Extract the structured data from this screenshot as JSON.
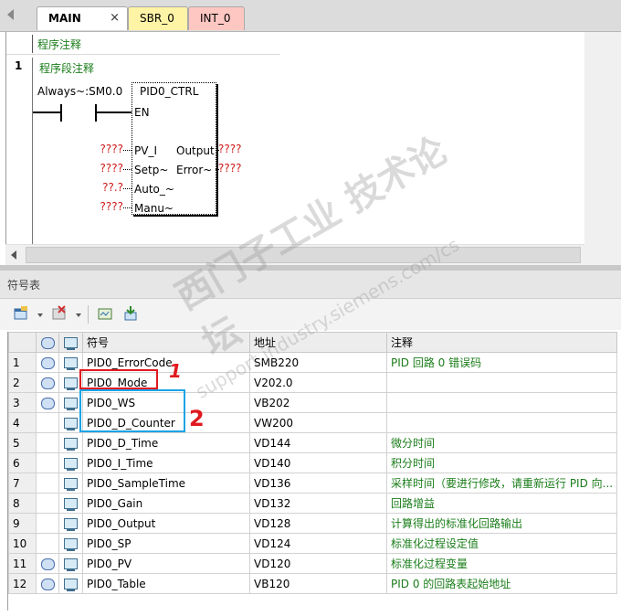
{
  "tabs": [
    {
      "label": "MAIN",
      "close": "×"
    },
    {
      "label": "SBR_0"
    },
    {
      "label": "INT_0"
    }
  ],
  "editor": {
    "program_comment": "程序注释",
    "network_number": "1",
    "network_comment": "程序段注释",
    "contact_label": "Always~:SM0.0",
    "block": {
      "title": "PID0_CTRL",
      "en": "EN",
      "inputs": [
        "PV_I",
        "Setp~",
        "Auto_~",
        "Manu~"
      ],
      "outputs": [
        "Output",
        "Error~"
      ]
    },
    "input_params": [
      "????",
      "????",
      "??.?",
      "????"
    ],
    "output_params": [
      "????",
      "????"
    ]
  },
  "symbol_panel": {
    "title": "符号表",
    "columns": [
      "符号",
      "地址",
      "注释"
    ],
    "rows": [
      {
        "num": "1",
        "globe": true,
        "symbol": "PID0_ErrorCode",
        "address": "SMB220",
        "comment": "PID 回路 0 错误码"
      },
      {
        "num": "2",
        "globe": true,
        "symbol": "PID0_Mode",
        "address": "V202.0",
        "comment": ""
      },
      {
        "num": "3",
        "globe": true,
        "symbol": "PID0_WS",
        "address": "VB202",
        "comment": ""
      },
      {
        "num": "4",
        "globe": false,
        "symbol": "PID0_D_Counter",
        "address": "VW200",
        "comment": ""
      },
      {
        "num": "5",
        "globe": false,
        "symbol": "PID0_D_Time",
        "address": "VD144",
        "comment": "微分时间"
      },
      {
        "num": "6",
        "globe": false,
        "symbol": "PID0_I_Time",
        "address": "VD140",
        "comment": "积分时间"
      },
      {
        "num": "7",
        "globe": false,
        "symbol": "PID0_SampleTime",
        "address": "VD136",
        "comment": "采样时间（要进行修改，请重新运行 PID 向..."
      },
      {
        "num": "8",
        "globe": false,
        "symbol": "PID0_Gain",
        "address": "VD132",
        "comment": "回路增益"
      },
      {
        "num": "9",
        "globe": false,
        "symbol": "PID0_Output",
        "address": "VD128",
        "comment": "计算得出的标准化回路输出"
      },
      {
        "num": "10",
        "globe": false,
        "symbol": "PID0_SP",
        "address": "VD124",
        "comment": "标准化过程设定值"
      },
      {
        "num": "11",
        "globe": true,
        "symbol": "PID0_PV",
        "address": "VD120",
        "comment": "标准化过程变量"
      },
      {
        "num": "12",
        "globe": true,
        "symbol": "PID0_Table",
        "address": "VB120",
        "comment": "PID 0 的回路表起始地址"
      }
    ]
  },
  "annotations": {
    "one": "1",
    "two": "2"
  },
  "watermark": {
    "text": "西门子工业 技术论坛",
    "url": "support.industry.siemens.com/cs"
  }
}
